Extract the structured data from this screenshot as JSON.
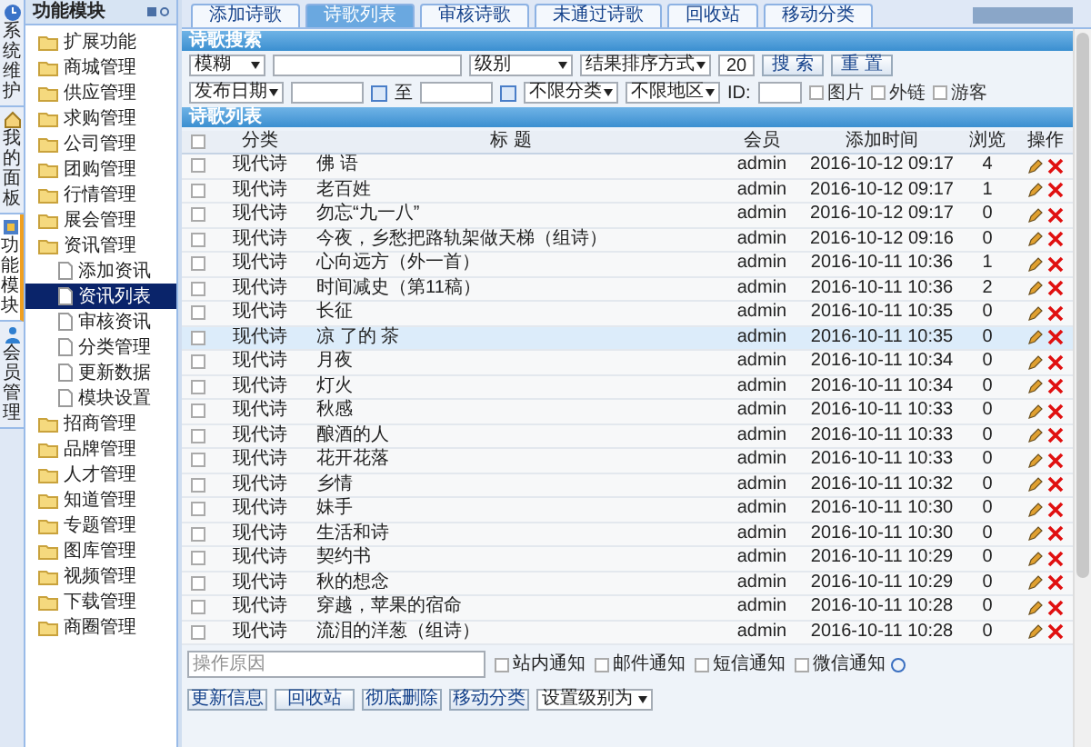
{
  "side_tabs": [
    {
      "label": "系统维护",
      "selected": false
    },
    {
      "label": "我的面板",
      "selected": false
    },
    {
      "label": "功能模块",
      "selected": true
    },
    {
      "label": "会员管理",
      "selected": false
    }
  ],
  "tree": {
    "title": "功能模块",
    "items": [
      {
        "label": "扩展功能",
        "kind": "folder"
      },
      {
        "label": "商城管理",
        "kind": "folder"
      },
      {
        "label": "供应管理",
        "kind": "folder"
      },
      {
        "label": "求购管理",
        "kind": "folder"
      },
      {
        "label": "公司管理",
        "kind": "folder"
      },
      {
        "label": "团购管理",
        "kind": "folder"
      },
      {
        "label": "行情管理",
        "kind": "folder"
      },
      {
        "label": "展会管理",
        "kind": "folder"
      },
      {
        "label": "资讯管理",
        "kind": "folder",
        "children": [
          {
            "label": "添加资讯",
            "kind": "page",
            "selected": false
          },
          {
            "label": "资讯列表",
            "kind": "page",
            "selected": true
          },
          {
            "label": "审核资讯",
            "kind": "page",
            "selected": false
          },
          {
            "label": "分类管理",
            "kind": "page",
            "selected": false
          },
          {
            "label": "更新数据",
            "kind": "page",
            "selected": false
          },
          {
            "label": "模块设置",
            "kind": "page",
            "selected": false
          }
        ]
      },
      {
        "label": "招商管理",
        "kind": "folder"
      },
      {
        "label": "品牌管理",
        "kind": "folder"
      },
      {
        "label": "人才管理",
        "kind": "folder"
      },
      {
        "label": "知道管理",
        "kind": "folder"
      },
      {
        "label": "专题管理",
        "kind": "folder"
      },
      {
        "label": "图库管理",
        "kind": "folder"
      },
      {
        "label": "视频管理",
        "kind": "folder"
      },
      {
        "label": "下载管理",
        "kind": "folder"
      },
      {
        "label": "商圈管理",
        "kind": "folder"
      }
    ]
  },
  "tabs": [
    {
      "label": "添加诗歌",
      "selected": false
    },
    {
      "label": "诗歌列表",
      "selected": true
    },
    {
      "label": "审核诗歌",
      "selected": false
    },
    {
      "label": "未通过诗歌",
      "selected": false
    },
    {
      "label": "回收站",
      "selected": false
    },
    {
      "label": "移动分类",
      "selected": false
    }
  ],
  "search": {
    "title": "诗歌搜索",
    "match": "模糊",
    "level": "级别",
    "order": "结果排序方式",
    "page_size": "20",
    "search_button": "搜 索",
    "reset_button": "重 置",
    "date_type": "发布日期",
    "to_label": "至",
    "category": "不限分类",
    "area": "不限地区",
    "id_label": "ID:",
    "filters": [
      {
        "label": "图片",
        "checked": false
      },
      {
        "label": "外链",
        "checked": false
      },
      {
        "label": "游客",
        "checked": false
      }
    ]
  },
  "list": {
    "title": "诗歌列表",
    "all_checked": false,
    "columns": [
      "分类",
      "标 题",
      "会员",
      "添加时间",
      "浏览",
      "操作"
    ],
    "rows": [
      {
        "category": "现代诗",
        "title": "佛 语",
        "member": "admin",
        "time": "2016-10-12 09:17",
        "views": "4",
        "selected": false
      },
      {
        "category": "现代诗",
        "title": "老百姓",
        "member": "admin",
        "time": "2016-10-12 09:17",
        "views": "1",
        "selected": false
      },
      {
        "category": "现代诗",
        "title": "勿忘“九一八”",
        "member": "admin",
        "time": "2016-10-12 09:17",
        "views": "0",
        "selected": false
      },
      {
        "category": "现代诗",
        "title": "今夜，乡愁把路轨架做天梯（组诗）",
        "member": "admin",
        "time": "2016-10-12 09:16",
        "views": "0",
        "selected": false
      },
      {
        "category": "现代诗",
        "title": "心向远方（外一首）",
        "member": "admin",
        "time": "2016-10-11 10:36",
        "views": "1",
        "selected": false
      },
      {
        "category": "现代诗",
        "title": "时间减史（第11稿）",
        "member": "admin",
        "time": "2016-10-11 10:36",
        "views": "2",
        "selected": false
      },
      {
        "category": "现代诗",
        "title": "长征",
        "member": "admin",
        "time": "2016-10-11 10:35",
        "views": "0",
        "selected": false
      },
      {
        "category": "现代诗",
        "title": "凉 了的 茶",
        "member": "admin",
        "time": "2016-10-11 10:35",
        "views": "0",
        "selected": true
      },
      {
        "category": "现代诗",
        "title": "月夜",
        "member": "admin",
        "time": "2016-10-11 10:34",
        "views": "0",
        "selected": false
      },
      {
        "category": "现代诗",
        "title": "灯火",
        "member": "admin",
        "time": "2016-10-11 10:34",
        "views": "0",
        "selected": false
      },
      {
        "category": "现代诗",
        "title": "秋感",
        "member": "admin",
        "time": "2016-10-11 10:33",
        "views": "0",
        "selected": false
      },
      {
        "category": "现代诗",
        "title": "酿酒的人",
        "member": "admin",
        "time": "2016-10-11 10:33",
        "views": "0",
        "selected": false
      },
      {
        "category": "现代诗",
        "title": "花开花落",
        "member": "admin",
        "time": "2016-10-11 10:33",
        "views": "0",
        "selected": false
      },
      {
        "category": "现代诗",
        "title": "乡情",
        "member": "admin",
        "time": "2016-10-11 10:32",
        "views": "0",
        "selected": false
      },
      {
        "category": "现代诗",
        "title": "妹手",
        "member": "admin",
        "time": "2016-10-11 10:30",
        "views": "0",
        "selected": false
      },
      {
        "category": "现代诗",
        "title": "生活和诗",
        "member": "admin",
        "time": "2016-10-11 10:30",
        "views": "0",
        "selected": false
      },
      {
        "category": "现代诗",
        "title": "契约书",
        "member": "admin",
        "time": "2016-10-11 10:29",
        "views": "0",
        "selected": false
      },
      {
        "category": "现代诗",
        "title": "秋的想念",
        "member": "admin",
        "time": "2016-10-11 10:29",
        "views": "0",
        "selected": false
      },
      {
        "category": "现代诗",
        "title": "穿越，苹果的宿命",
        "member": "admin",
        "time": "2016-10-11 10:28",
        "views": "0",
        "selected": false
      },
      {
        "category": "现代诗",
        "title": "流泪的洋葱（组诗）",
        "member": "admin",
        "time": "2016-10-11 10:28",
        "views": "0",
        "selected": false
      }
    ]
  },
  "footer": {
    "reason_placeholder": "操作原因",
    "notices": [
      {
        "label": "站内通知",
        "checked": false
      },
      {
        "label": "邮件通知",
        "checked": false
      },
      {
        "label": "短信通知",
        "checked": false
      },
      {
        "label": "微信通知",
        "checked": false
      }
    ],
    "buttons": [
      "更新信息",
      "回收站",
      "彻底删除",
      "移动分类"
    ],
    "level_select": "设置级别为"
  }
}
